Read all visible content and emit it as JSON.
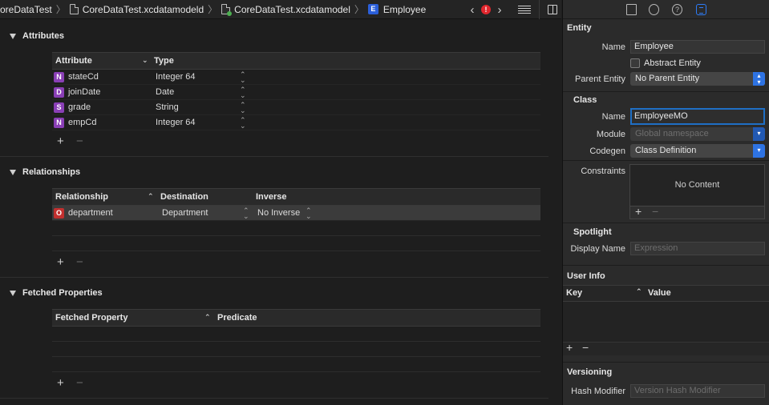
{
  "jumpbar": {
    "crumbs": [
      "oreDataTest",
      "CoreDataTest.xcdatamodeld",
      "CoreDataTest.xcdatamodel",
      "Employee"
    ],
    "entity_badge": "E",
    "error_badge": "!"
  },
  "attributes": {
    "title": "Attributes",
    "col_attribute": "Attribute",
    "col_type": "Type",
    "rows": [
      {
        "badge": "N",
        "name": "stateCd",
        "type": "Integer 64"
      },
      {
        "badge": "D",
        "name": "joinDate",
        "type": "Date"
      },
      {
        "badge": "S",
        "name": "grade",
        "type": "String"
      },
      {
        "badge": "N",
        "name": "empCd",
        "type": "Integer 64"
      }
    ]
  },
  "relationships": {
    "title": "Relationships",
    "col_relationship": "Relationship",
    "col_destination": "Destination",
    "col_inverse": "Inverse",
    "rows": [
      {
        "badge": "O",
        "name": "department",
        "destination": "Department",
        "inverse": "No Inverse"
      }
    ]
  },
  "fetched": {
    "title": "Fetched Properties",
    "col_property": "Fetched Property",
    "col_predicate": "Predicate"
  },
  "controls": {
    "plus": "+",
    "minus": "−"
  },
  "inspector": {
    "entity": {
      "title": "Entity",
      "name_label": "Name",
      "name_value": "Employee",
      "abstract_label": "Abstract Entity",
      "parent_label": "Parent Entity",
      "parent_value": "No Parent Entity"
    },
    "class": {
      "title": "Class",
      "name_label": "Name",
      "name_value": "EmployeeMO",
      "module_label": "Module",
      "module_value": "Global namespace",
      "codegen_label": "Codegen",
      "codegen_value": "Class Definition"
    },
    "constraints": {
      "label": "Constraints",
      "empty": "No Content"
    },
    "spotlight": {
      "title": "Spotlight",
      "display_label": "Display Name",
      "display_placeholder": "Expression"
    },
    "user_info": {
      "title": "User Info",
      "col_key": "Key",
      "col_value": "Value"
    },
    "versioning": {
      "title": "Versioning",
      "hash_label": "Hash Modifier",
      "hash_placeholder": "Version Hash Modifier"
    },
    "help_glyph": "?"
  }
}
